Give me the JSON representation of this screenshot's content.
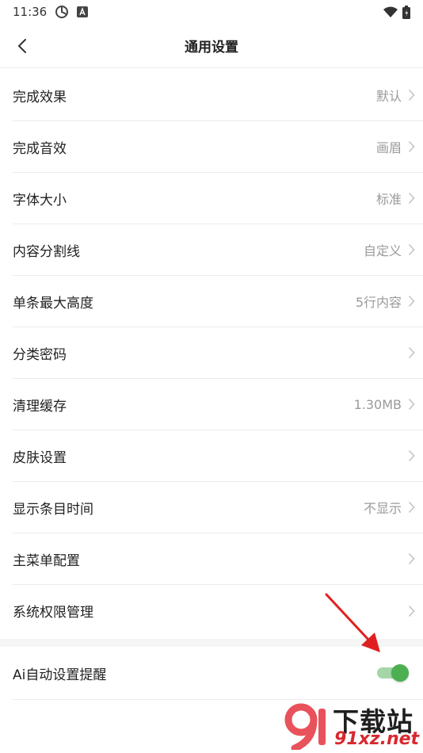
{
  "status_bar": {
    "time": "11:36"
  },
  "header": {
    "title": "通用设置"
  },
  "settings": [
    {
      "label": "完成效果",
      "value": "默认"
    },
    {
      "label": "完成音效",
      "value": "画眉"
    },
    {
      "label": "字体大小",
      "value": "标准"
    },
    {
      "label": "内容分割线",
      "value": "自定义"
    },
    {
      "label": "单条最大高度",
      "value": "5行内容"
    },
    {
      "label": "分类密码",
      "value": ""
    },
    {
      "label": "清理缓存",
      "value": "1.30MB"
    },
    {
      "label": "皮肤设置",
      "value": ""
    },
    {
      "label": "显示条目时间",
      "value": "不显示"
    },
    {
      "label": "主菜单配置",
      "value": ""
    },
    {
      "label": "系统权限管理",
      "value": ""
    }
  ],
  "ai_reminder": {
    "label": "Ai自动设置提醒",
    "enabled": true
  },
  "watermark": {
    "title": "下载站",
    "domain": "91xz.net"
  },
  "colors": {
    "toggle_on": "#4caf50",
    "value_text": "#9a9a9a",
    "annotation_arrow": "#e02020"
  }
}
